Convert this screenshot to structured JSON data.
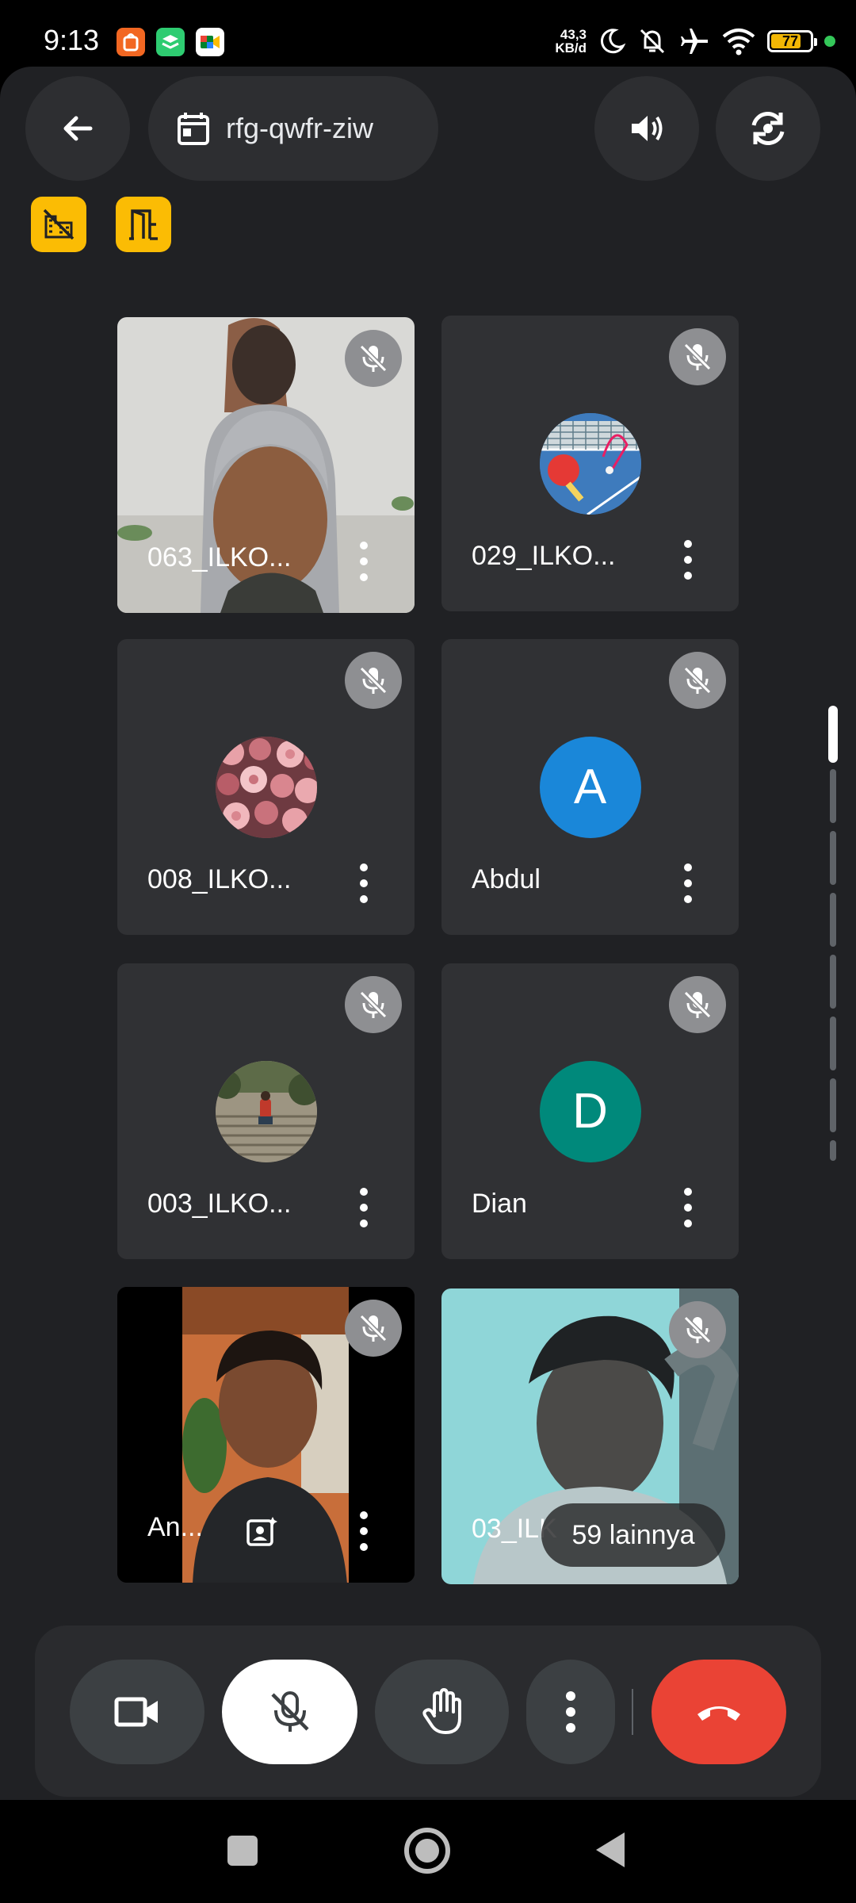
{
  "status_bar": {
    "time": "9:13",
    "net_rate_value": "43,3",
    "net_rate_unit": "KB/d",
    "battery": "77",
    "battery_level": 0.77,
    "icons": [
      "shopee-app-icon",
      "layers-app-icon",
      "meet-app-icon",
      "moon-icon",
      "bell-off-icon",
      "airplane-icon",
      "wifi-icon",
      "battery-icon"
    ]
  },
  "header": {
    "back_icon": "arrow-back-icon",
    "meeting_code": "rfg-qwfr-ziw",
    "speaker_icon": "volume-icon",
    "switch_camera_icon": "switch-camera-icon",
    "yellow_icons": [
      "blur-off-icon",
      "door-icon"
    ]
  },
  "participants": [
    {
      "name": "063_ILKO...",
      "muted": true,
      "type": "video"
    },
    {
      "name": "029_ILKO...",
      "muted": true,
      "type": "avatar-image"
    },
    {
      "name": "008_ILKO...",
      "muted": true,
      "type": "avatar-image"
    },
    {
      "name": "Abdul",
      "muted": true,
      "type": "initial",
      "initial": "A",
      "color": "#1a87d9"
    },
    {
      "name": "003_ILKO...",
      "muted": true,
      "type": "avatar-image"
    },
    {
      "name": "Dian",
      "muted": true,
      "type": "initial",
      "initial": "D",
      "color": "#00897b"
    },
    {
      "name": "An...",
      "muted": true,
      "type": "video"
    },
    {
      "name": "03_ILK",
      "muted": true,
      "type": "video"
    }
  ],
  "overflow": {
    "label": "59 lainnya"
  },
  "controls": {
    "camera_icon": "videocam-icon",
    "mic_icon": "mic-off-icon",
    "hand_icon": "raise-hand-icon",
    "more_icon": "more-vert-icon",
    "end_call_icon": "call-end-icon",
    "end_call_color": "#ea4335"
  },
  "nav": {
    "icons": [
      "recents-square-icon",
      "home-circle-icon",
      "back-triangle-icon"
    ]
  },
  "colors": {
    "accent_yellow": "#fbbc04",
    "surface": "#202124",
    "tile": "#303134"
  }
}
